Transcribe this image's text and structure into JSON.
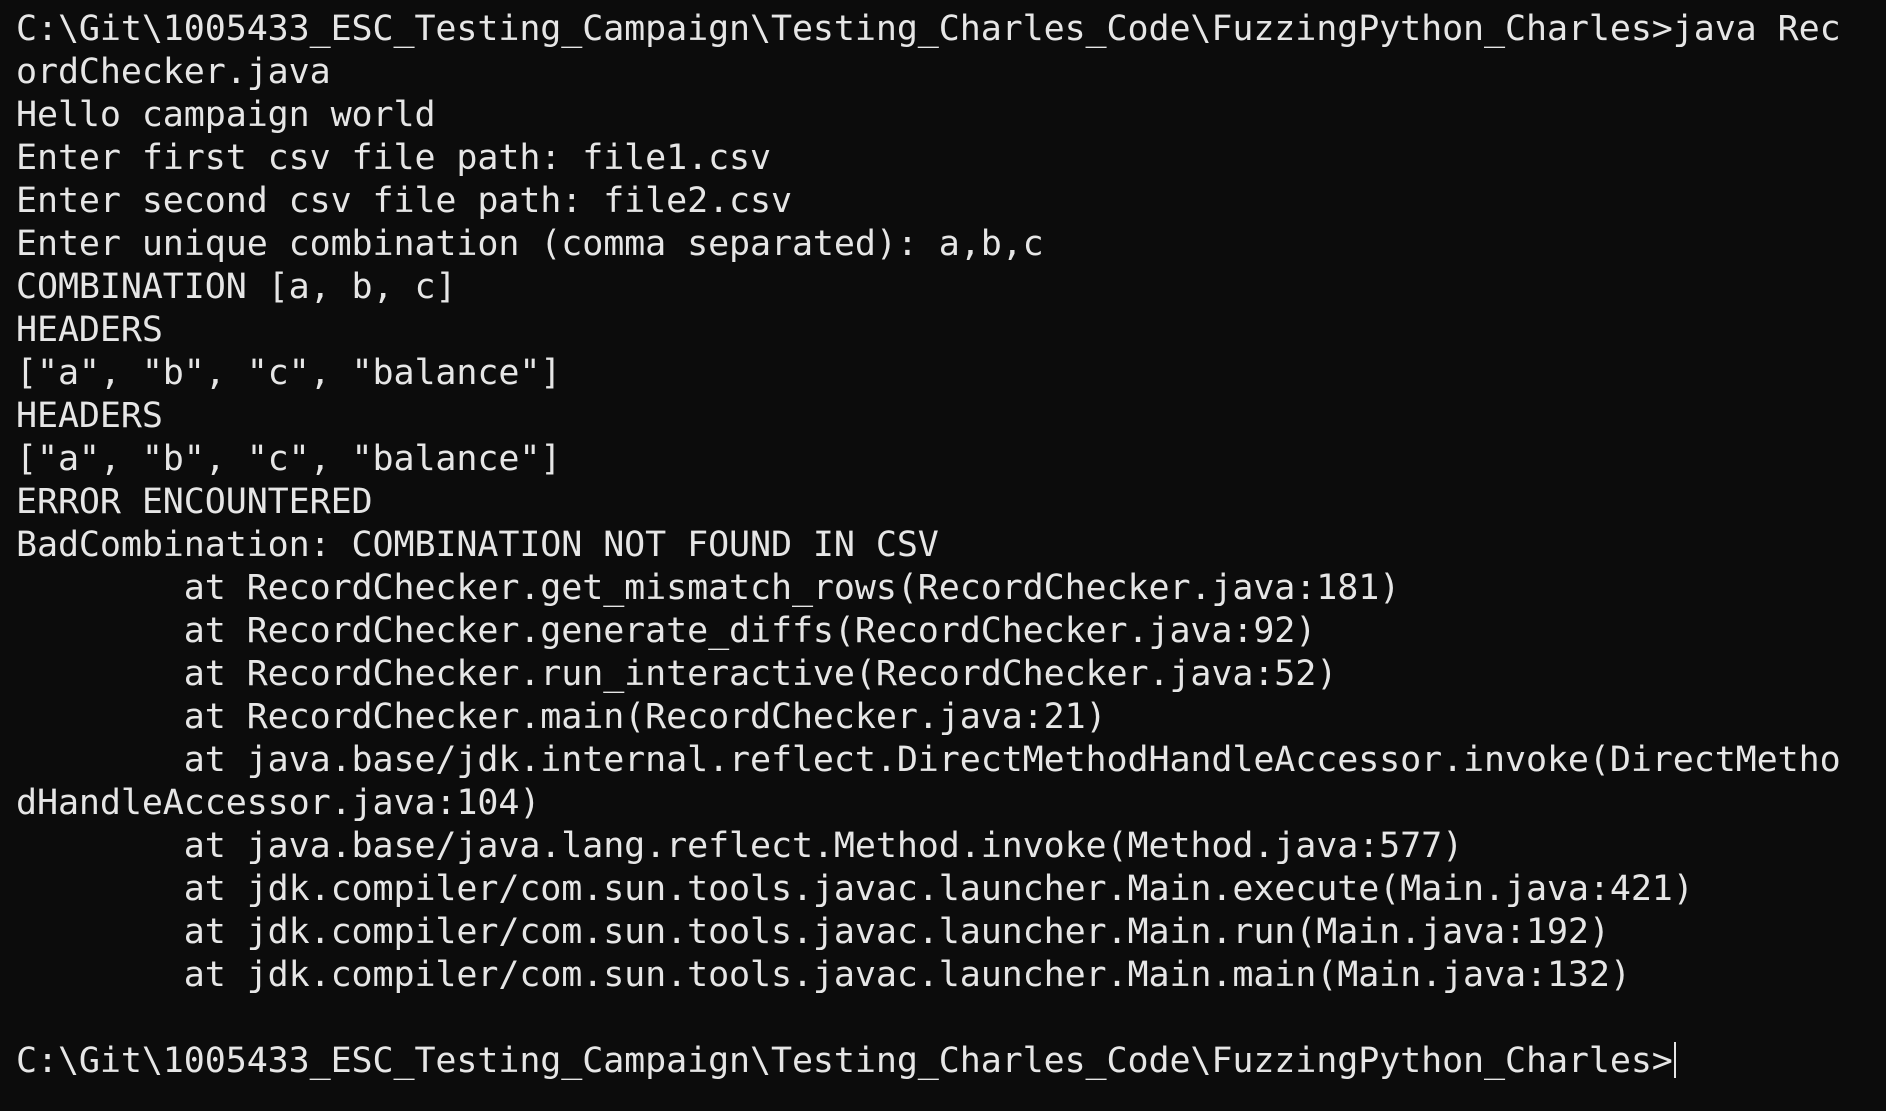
{
  "terminal": {
    "lines": [
      "C:\\Git\\1005433_ESC_Testing_Campaign\\Testing_Charles_Code\\FuzzingPython_Charles>java Rec",
      "ordChecker.java",
      "Hello campaign world",
      "Enter first csv file path: file1.csv",
      "Enter second csv file path: file2.csv",
      "Enter unique combination (comma separated): a,b,c",
      "COMBINATION [a, b, c]",
      "HEADERS",
      "[\"a\", \"b\", \"c\", \"balance\"]",
      "HEADERS",
      "[\"a\", \"b\", \"c\", \"balance\"]",
      "ERROR ENCOUNTERED",
      "BadCombination: COMBINATION NOT FOUND IN CSV",
      "        at RecordChecker.get_mismatch_rows(RecordChecker.java:181)",
      "        at RecordChecker.generate_diffs(RecordChecker.java:92)",
      "        at RecordChecker.run_interactive(RecordChecker.java:52)",
      "        at RecordChecker.main(RecordChecker.java:21)",
      "        at java.base/jdk.internal.reflect.DirectMethodHandleAccessor.invoke(DirectMetho",
      "dHandleAccessor.java:104)",
      "        at java.base/java.lang.reflect.Method.invoke(Method.java:577)",
      "        at jdk.compiler/com.sun.tools.javac.launcher.Main.execute(Main.java:421)",
      "        at jdk.compiler/com.sun.tools.javac.launcher.Main.run(Main.java:192)",
      "        at jdk.compiler/com.sun.tools.javac.launcher.Main.main(Main.java:132)"
    ],
    "prompt": "C:\\Git\\1005433_ESC_Testing_Campaign\\Testing_Charles_Code\\FuzzingPython_Charles>"
  }
}
